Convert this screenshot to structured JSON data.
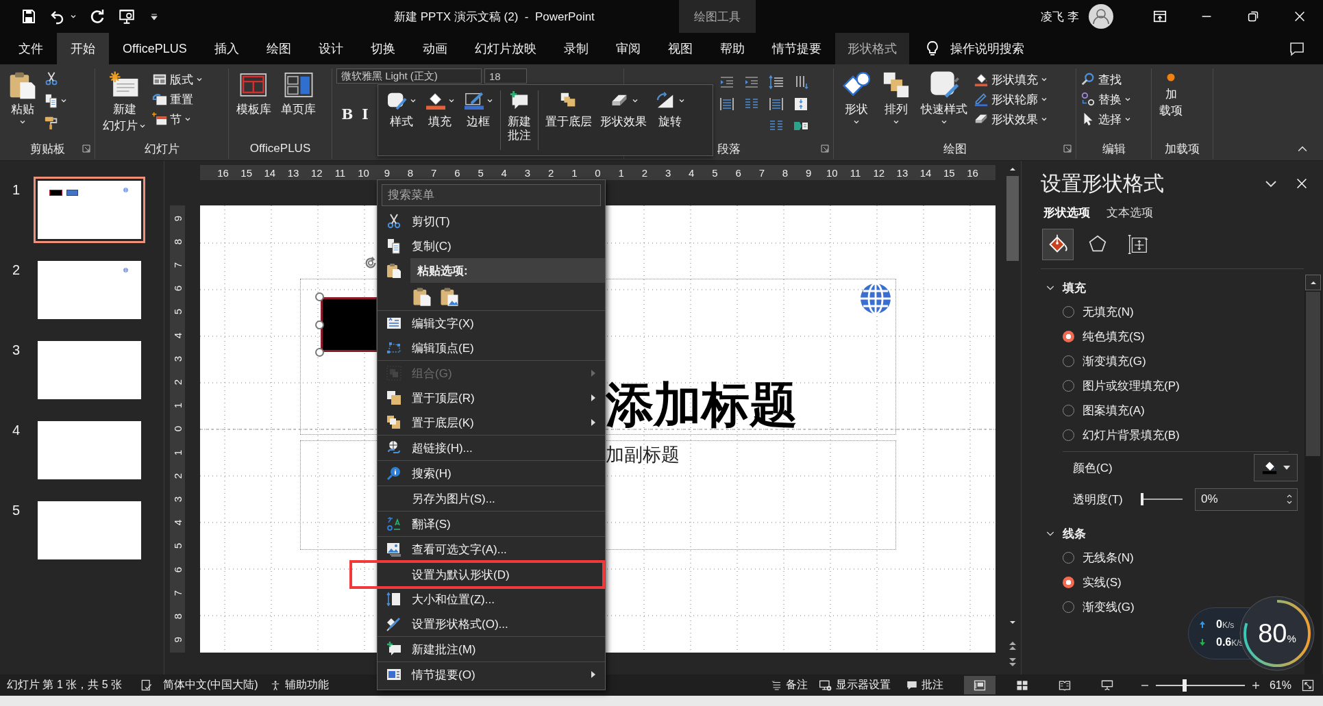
{
  "title_bar": {
    "title": "新建 PPTX 演示文稿 (2)  -  PowerPoint",
    "context_label": "绘图工具",
    "user_name": "凌飞 李"
  },
  "tabs": [
    {
      "label": "文件",
      "kind": "tab",
      "selected": false
    },
    {
      "label": "开始",
      "kind": "tab",
      "selected": true
    },
    {
      "label": "OfficePLUS",
      "kind": "tab",
      "selected": false
    },
    {
      "label": "插入",
      "kind": "tab",
      "selected": false
    },
    {
      "label": "绘图",
      "kind": "tab",
      "selected": false
    },
    {
      "label": "设计",
      "kind": "tab",
      "selected": false
    },
    {
      "label": "切换",
      "kind": "tab",
      "selected": false
    },
    {
      "label": "动画",
      "kind": "tab",
      "selected": false
    },
    {
      "label": "幻灯片放映",
      "kind": "tab",
      "selected": false
    },
    {
      "label": "录制",
      "kind": "tab",
      "selected": false
    },
    {
      "label": "审阅",
      "kind": "tab",
      "selected": false
    },
    {
      "label": "视图",
      "kind": "tab",
      "selected": false
    },
    {
      "label": "帮助",
      "kind": "tab",
      "selected": false
    },
    {
      "label": "情节提要",
      "kind": "tab",
      "selected": false
    },
    {
      "label": "形状格式",
      "kind": "context",
      "selected": false
    }
  ],
  "tell_me": "操作说明搜索",
  "ribbon": {
    "groups": [
      {
        "kind": "clipboard",
        "label": "剪贴板",
        "launcher": true,
        "buttons": [
          {
            "kind": "large",
            "label": "粘贴",
            "dropdown": true
          }
        ]
      },
      {
        "kind": "slides",
        "label": "幻灯片",
        "launcher": false,
        "buttons": [
          {
            "kind": "large",
            "lines": [
              "新建",
              "幻灯片"
            ],
            "dropdown": true
          },
          {
            "kind": "small",
            "label": "版式",
            "dropdown": true
          },
          {
            "kind": "small",
            "label": "重置",
            "dropdown": false
          },
          {
            "kind": "small",
            "label": "节",
            "dropdown": true
          }
        ]
      },
      {
        "kind": "officeplus",
        "label": "OfficePLUS",
        "launcher": false,
        "buttons": [
          {
            "kind": "large",
            "label": "模板库",
            "dropdown": false
          },
          {
            "kind": "large",
            "label": "单页库",
            "dropdown": false
          }
        ]
      },
      {
        "kind": "font",
        "font_name": "微软雅黑 Light (正文)",
        "font_size": "18",
        "buttons": [
          {
            "kind": "format",
            "label": "B"
          },
          {
            "kind": "format",
            "label": "I"
          }
        ]
      },
      {
        "kind": "paragraph",
        "label": "段落",
        "launcher": true
      },
      {
        "kind": "drawing",
        "label": "绘图",
        "launcher": true,
        "buttons": [
          {
            "kind": "large",
            "label": "形状",
            "dropdown": true
          },
          {
            "kind": "large",
            "label": "排列",
            "dropdown": true
          },
          {
            "kind": "large",
            "label": "快速样式",
            "dropdown": true
          },
          {
            "kind": "small",
            "label": "形状填充",
            "dropdown": true
          },
          {
            "kind": "small",
            "label": "形状轮廓",
            "dropdown": true
          },
          {
            "kind": "small",
            "label": "形状效果",
            "dropdown": true
          }
        ]
      },
      {
        "kind": "editing",
        "label": "编辑",
        "launcher": false,
        "buttons": [
          {
            "kind": "small",
            "label": "查找",
            "dropdown": false
          },
          {
            "kind": "small",
            "label": "替换",
            "dropdown": true
          },
          {
            "kind": "small",
            "label": "选择",
            "dropdown": true
          }
        ]
      },
      {
        "kind": "addins",
        "label": "加载项",
        "launcher": false,
        "buttons": [
          {
            "kind": "large",
            "lines": [
              "加",
              "载项"
            ],
            "dropdown": false
          }
        ]
      }
    ]
  },
  "mini_toolbar": {
    "groups": [
      [
        {
          "label": "样式",
          "dropdown": true
        },
        {
          "label": "填充",
          "dropdown": true
        },
        {
          "label": "边框",
          "dropdown": true
        }
      ],
      [
        {
          "lines": [
            "新建",
            "批注"
          ],
          "dropdown": false
        }
      ],
      [
        {
          "label": "置于底层",
          "dropdown": false
        },
        {
          "label": "形状效果",
          "dropdown": true
        },
        {
          "label": "旋转",
          "dropdown": true
        }
      ]
    ]
  },
  "thumbnails": [
    {
      "number": "1",
      "selected": true,
      "objects": [
        {
          "kind": "dark-rect"
        },
        {
          "kind": "blue-rect"
        },
        {
          "kind": "globe"
        }
      ]
    },
    {
      "number": "2",
      "selected": false,
      "objects": [
        {
          "kind": "globe"
        }
      ]
    },
    {
      "number": "3",
      "selected": false
    },
    {
      "number": "4",
      "selected": false
    },
    {
      "number": "5",
      "selected": false
    }
  ],
  "editor": {
    "h_ruler": [
      "16",
      "15",
      "14",
      "13",
      "12",
      "11",
      "10",
      "9",
      "8",
      "7",
      "6",
      "5",
      "4",
      "3",
      "2",
      "1",
      "0",
      "1",
      "2",
      "3",
      "4",
      "5",
      "6",
      "7",
      "8",
      "9",
      "10",
      "11",
      "12",
      "13",
      "14",
      "15",
      "16"
    ],
    "v_ruler": [
      "9",
      "8",
      "7",
      "6",
      "5",
      "4",
      "3",
      "2",
      "1",
      "0",
      "1",
      "2",
      "3",
      "4",
      "5",
      "6",
      "7",
      "8",
      "9"
    ],
    "title": "添加标题",
    "subtitle": "加副标题"
  },
  "context_menu": {
    "search_placeholder": "搜索菜单",
    "sections": [
      [
        {
          "kind": "item",
          "label": "剪切(T)",
          "disabled": false,
          "submenu": false,
          "marked": false
        },
        {
          "kind": "item",
          "label": "复制(C)",
          "disabled": false,
          "submenu": false,
          "marked": false
        },
        {
          "kind": "header",
          "label": "粘贴选项:"
        },
        {
          "kind": "paste-options"
        }
      ],
      [
        {
          "kind": "item",
          "label": "编辑文字(X)",
          "disabled": false,
          "submenu": false,
          "marked": false
        },
        {
          "kind": "item",
          "label": "编辑顶点(E)",
          "disabled": false,
          "submenu": false,
          "marked": false
        }
      ],
      [
        {
          "kind": "item",
          "label": "组合(G)",
          "disabled": true,
          "submenu": true,
          "marked": false
        },
        {
          "kind": "item",
          "label": "置于顶层(R)",
          "disabled": false,
          "submenu": true,
          "marked": false
        },
        {
          "kind": "item",
          "label": "置于底层(K)",
          "disabled": false,
          "submenu": true,
          "marked": false
        }
      ],
      [
        {
          "kind": "item",
          "label": "超链接(H)...",
          "disabled": false,
          "submenu": false,
          "marked": false
        }
      ],
      [
        {
          "kind": "item",
          "label": "搜索(H)",
          "disabled": false,
          "submenu": false,
          "marked": false
        }
      ],
      [
        {
          "kind": "item",
          "label": "另存为图片(S)...",
          "disabled": false,
          "submenu": false,
          "marked": false
        }
      ],
      [
        {
          "kind": "item",
          "label": "翻译(S)",
          "disabled": false,
          "submenu": false,
          "marked": false
        }
      ],
      [
        {
          "kind": "item",
          "label": "查看可选文字(A)...",
          "disabled": false,
          "submenu": false,
          "marked": false
        }
      ],
      [
        {
          "kind": "item",
          "label": "设置为默认形状(D)",
          "disabled": false,
          "submenu": false,
          "marked": true
        },
        {
          "kind": "item",
          "label": "大小和位置(Z)...",
          "disabled": false,
          "submenu": false,
          "marked": false
        },
        {
          "kind": "item",
          "label": "设置形状格式(O)...",
          "disabled": false,
          "submenu": false,
          "marked": false
        }
      ],
      [
        {
          "kind": "item",
          "label": "新建批注(M)",
          "disabled": false,
          "submenu": false,
          "marked": false
        }
      ],
      [
        {
          "kind": "item",
          "label": "情节提要(O)",
          "disabled": false,
          "submenu": true,
          "marked": false
        }
      ]
    ]
  },
  "format_pane": {
    "title": "设置形状格式",
    "tabs": [
      {
        "label": "形状选项",
        "selected": true
      },
      {
        "label": "文本选项",
        "selected": false
      }
    ],
    "icon_tabs": [
      {
        "selected": true
      },
      {
        "selected": false
      },
      {
        "selected": false
      }
    ],
    "sections": [
      {
        "title": "填充",
        "expanded": true,
        "options": [
          {
            "label": "无填充(N)",
            "selected": false
          },
          {
            "label": "纯色填充(S)",
            "selected": true
          },
          {
            "label": "渐变填充(G)",
            "selected": false
          },
          {
            "label": "图片或纹理填充(P)",
            "selected": false
          },
          {
            "label": "图案填充(A)",
            "selected": false
          },
          {
            "label": "幻灯片背景填充(B)",
            "selected": false
          }
        ],
        "color_label": "颜色(C)",
        "transparency_label": "透明度(T)",
        "transparency": {
          "level": 0,
          "value": "0%"
        }
      },
      {
        "title": "线条",
        "expanded": true,
        "options": [
          {
            "label": "无线条(N)",
            "selected": false
          },
          {
            "label": "实线(S)",
            "selected": true
          },
          {
            "label": "渐变线(G)",
            "selected": false
          }
        ]
      }
    ]
  },
  "status_bar": {
    "slide_info": "幻灯片 第 1 张，共 5 张",
    "language": "简体中文(中国大陆)",
    "accessibility": "辅助功能",
    "notes": "备注",
    "display": "显示器设置",
    "comments": "批注",
    "views": [
      {
        "selected": true
      },
      {
        "selected": false
      },
      {
        "selected": false
      },
      {
        "selected": false
      }
    ],
    "zoom": {
      "level": 0.32,
      "value": "61%"
    }
  },
  "speed_widget": {
    "upload": "0",
    "upload_unit": "K/s",
    "download": "0.6",
    "download_unit": "K/s",
    "load": "80",
    "load_unit": "%"
  }
}
